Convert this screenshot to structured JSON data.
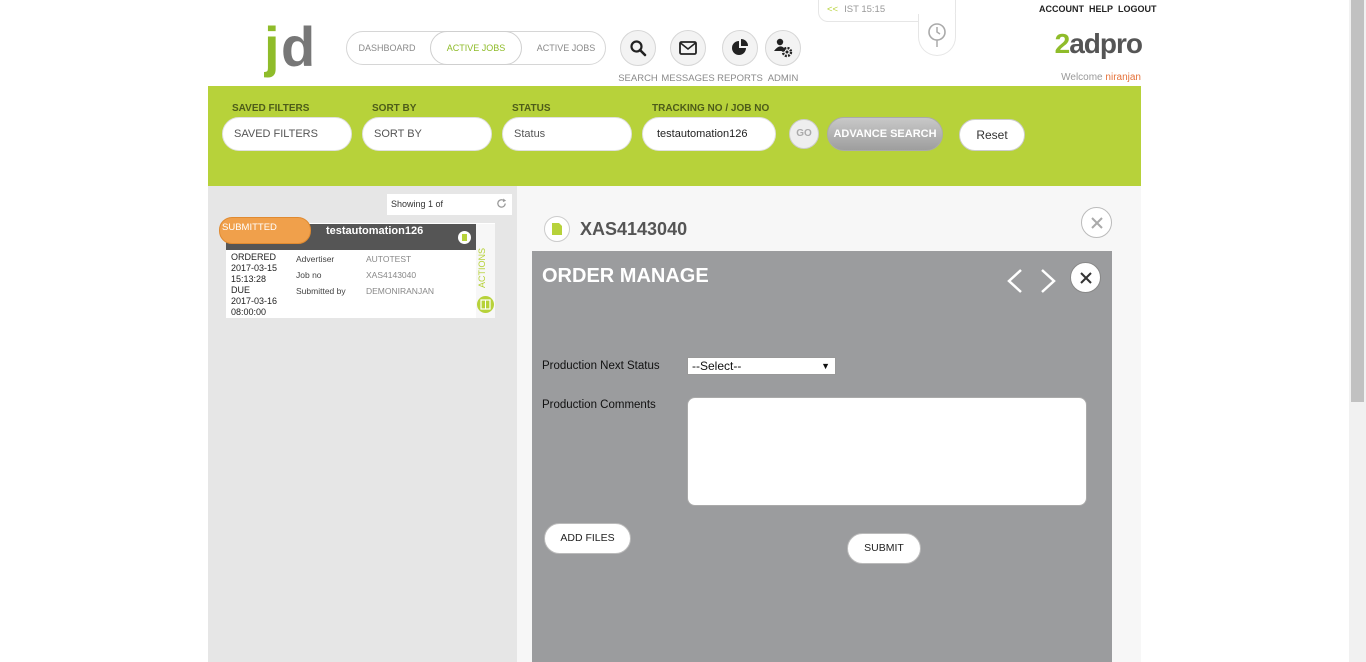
{
  "header": {
    "logo_text": "jd",
    "nav_tabs": [
      {
        "label": "DASHBOARD"
      },
      {
        "label": "ACTIVE JOBS"
      },
      {
        "label": "ACTIVE JOBS"
      }
    ],
    "icon_buttons": [
      {
        "label": "SEARCH",
        "icon": "search-icon"
      },
      {
        "label": "MESSAGES",
        "icon": "envelope-icon"
      },
      {
        "label": "REPORTS",
        "icon": "pie-chart-icon"
      },
      {
        "label": "ADMIN",
        "icon": "users-gear-icon"
      }
    ],
    "clock": {
      "arrow": "<<",
      "time": "IST 15:15"
    },
    "top_links": [
      "ACCOUNT",
      "HELP",
      "LOGOUT"
    ],
    "brand": {
      "part1": "2",
      "part2": "adpro"
    },
    "welcome": {
      "text": "Welcome",
      "user": "niranjan"
    }
  },
  "filters": {
    "saved_filters": {
      "label": "SAVED FILTERS",
      "value": "SAVED FILTERS"
    },
    "sort_by": {
      "label": "SORT BY",
      "value": "SORT BY"
    },
    "status": {
      "label": "STATUS",
      "value": "Status"
    },
    "tracking": {
      "label": "TRACKING NO / JOB NO",
      "value": "testautomation126"
    },
    "go_label": "GO",
    "advance_label": "ADVANCE SEARCH",
    "reset_label": "Reset"
  },
  "job_list": {
    "showing": "Showing 1 of",
    "card": {
      "status": "SUBMITTED",
      "title": "testautomation126",
      "ordered_label": "ORDERED",
      "ordered_date": "2017-03-15",
      "ordered_time": "15:13:28",
      "due_label": "DUE",
      "due_date": "2017-03-16",
      "due_time": "08:00:00",
      "advertiser_label": "Advertiser",
      "advertiser": "AUTOTEST",
      "jobno_label": "Job no",
      "jobno": "XAS4143040",
      "submitted_label": "Submitted by",
      "submitted_by": "DEMONIRANJAN",
      "actions_label": "ACTIONS"
    }
  },
  "detail": {
    "job_id": "XAS4143040",
    "modal_title": "ORDER MANAGE",
    "next_status_label": "Production Next Status",
    "next_status_value": "--Select--",
    "comments_label": "Production Comments",
    "comments_value": "",
    "add_files_label": "ADD FILES",
    "submit_label": "SUBMIT"
  },
  "colors": {
    "accent": "#b7d23a",
    "status_orange": "#f0a04b",
    "modal_bg": "#9b9c9e"
  }
}
